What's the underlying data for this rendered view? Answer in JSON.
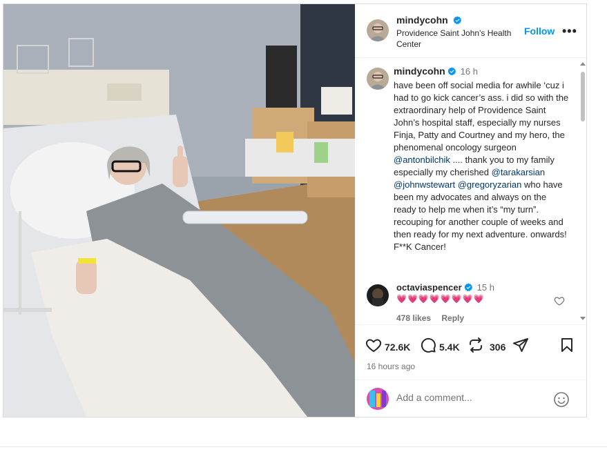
{
  "post": {
    "author": {
      "username": "mindycohn",
      "location": "Providence Saint John's Health Center",
      "follow_label": "Follow",
      "more_label": "•••"
    },
    "caption": {
      "username": "mindycohn",
      "time": "16 h",
      "segments": [
        "have been off social media for awhile ‘cuz i had to go kick cancer’s ass.  i did so with the extraordinary help of Providence Saint John’s hospital staff, especially my nurses Finja, Patty and Courtney and my hero, the phenomenal oncology surgeon ",
        "@antonbilchik",
        " .... thank you to my family especially my cherished ",
        "@tarakarsian",
        " ",
        "@johnwstewart",
        " ",
        "@gregoryzarian",
        " who have been my advocates and always on the ready to help me when it’s “my turn”. recouping for another couple of weeks and then ready for my next adventure.  onwards! F**K Cancer!"
      ]
    },
    "comment": {
      "username": "octaviaspencer",
      "time": "15 h",
      "text": "💗💗💗💗💗💗💗💗",
      "likes": "478 likes",
      "reply_label": "Reply"
    },
    "stats": {
      "likes": "72.6K",
      "comments": "5.4K",
      "reposts": "306"
    },
    "ago": "16 hours ago",
    "add_comment_placeholder": "Add a comment..."
  },
  "colors": {
    "accent": "#0095f6",
    "mention": "#00376b",
    "verified": "#0095f6",
    "muted": "#737373"
  },
  "icons": [
    "verified-badge-icon",
    "more-icon",
    "heart-icon",
    "comment-icon",
    "repost-icon",
    "share-icon",
    "bookmark-icon",
    "emoji-icon"
  ]
}
